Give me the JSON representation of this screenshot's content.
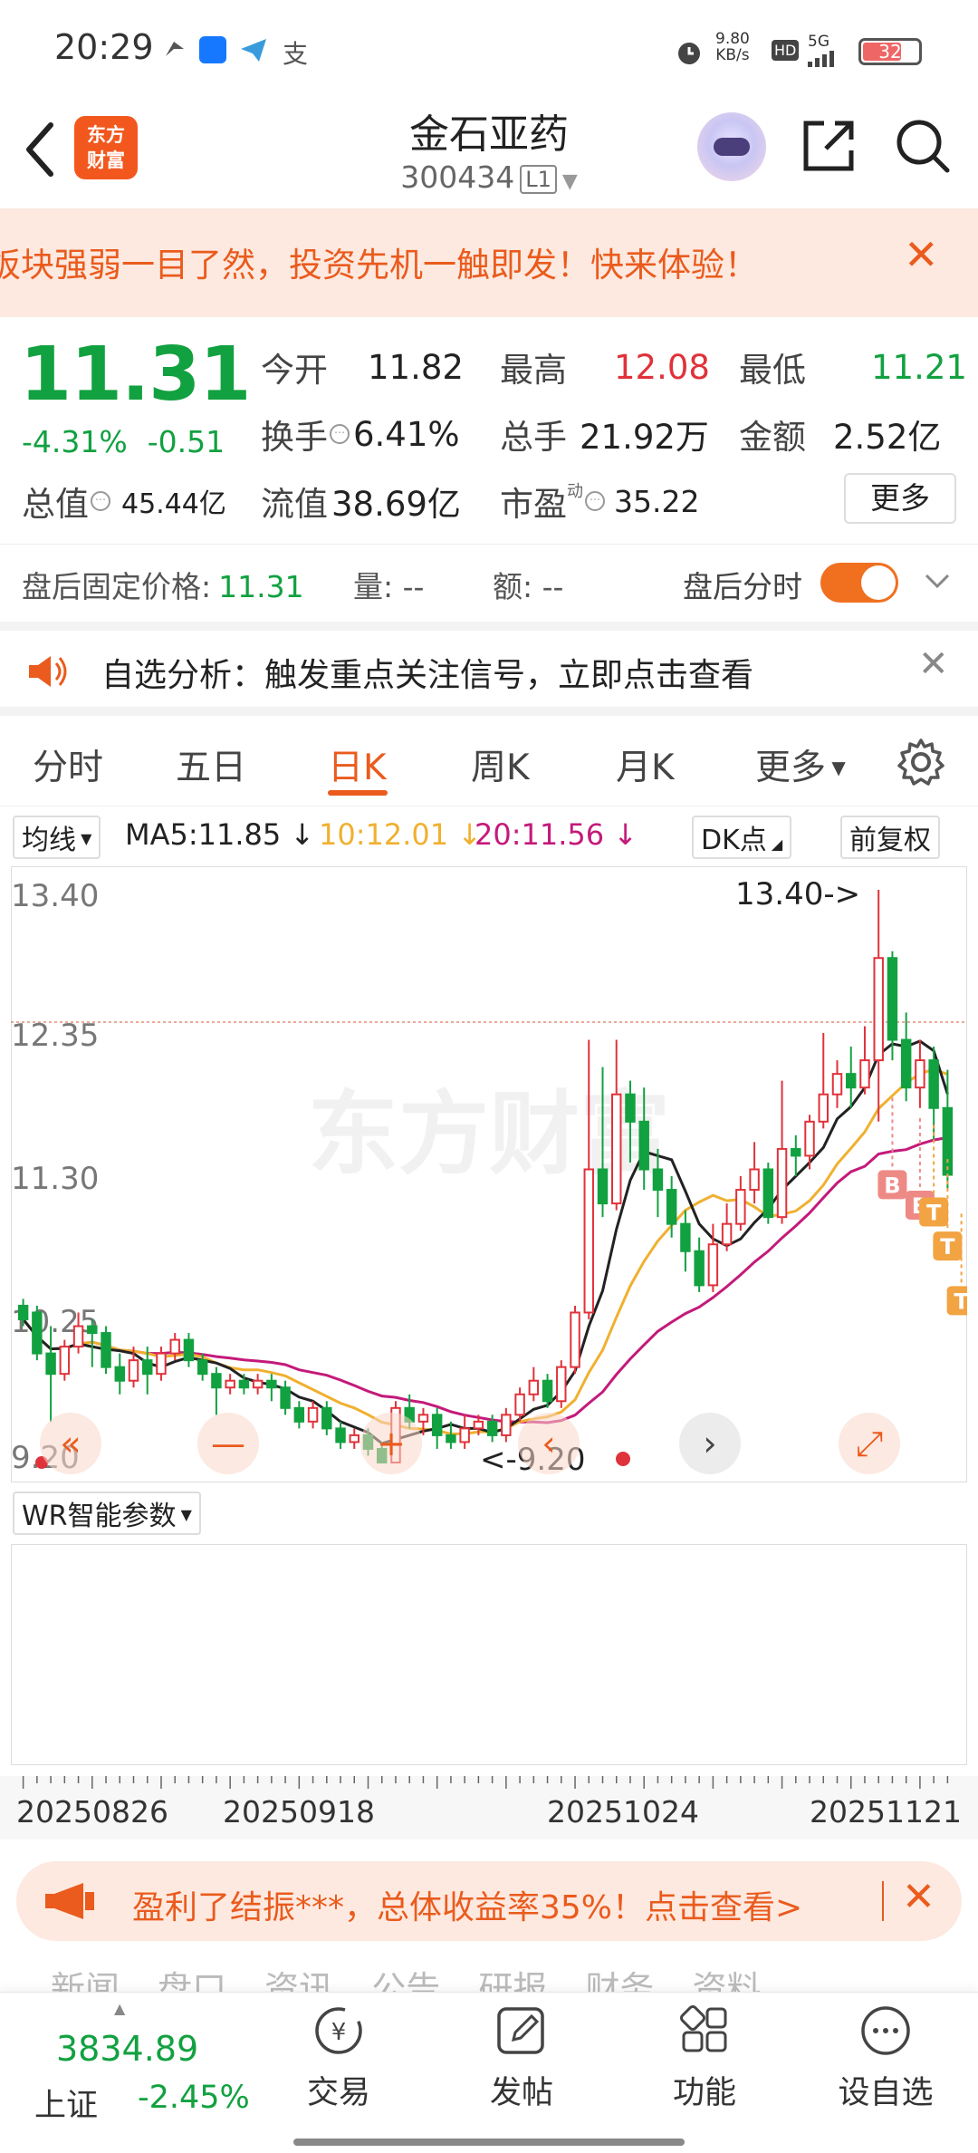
{
  "status_bar": {
    "time": "20:29",
    "net_speed_top": "9.80",
    "net_speed_unit": "KB/s",
    "hd": "HD",
    "signal": "5G",
    "battery": "32"
  },
  "header": {
    "logo_line1": "东方",
    "logo_line2": "财富",
    "title": "金石亚药",
    "code": "300434",
    "code_tag": "L1"
  },
  "promo_top": {
    "text": "板块强弱一目了然，投资先机一触即发！快来体验！",
    "close": "✕"
  },
  "quote": {
    "price": "11.31",
    "change_pct": "-4.31%",
    "change_abs": "-0.51",
    "open_label": "今开",
    "open": "11.82",
    "high_label": "最高",
    "high": "12.08",
    "low_label": "最低",
    "low": "11.21",
    "turnover_label": "换手",
    "turnover": "6.41%",
    "volume_label": "总手",
    "volume": "21.92万",
    "amount_label": "金额",
    "amount": "2.52亿",
    "total_value_label": "总值",
    "total_value": "45.44亿",
    "float_value_label": "流值",
    "float_value": "38.69亿",
    "pe_label": "市盈",
    "pe_sup": "动",
    "pe": "35.22",
    "more": "更多"
  },
  "after_hours": {
    "label": "盘后固定价格:",
    "price": "11.31",
    "vol_label": "量:",
    "vol": "--",
    "amt_label": "额:",
    "amt": "--",
    "toggle_label": "盘后分时"
  },
  "notice": {
    "text": "自选分析：触发重点关注信号，立即点击查看",
    "close": "✕"
  },
  "tabs": [
    "分时",
    "五日",
    "日K",
    "周K",
    "月K",
    "更多"
  ],
  "ma": {
    "selector": "均线",
    "ma5": "MA5:11.85 ↓",
    "ma10": "10:12.01 ↓",
    "ma20": "20:11.56 ↓",
    "dk": "DK点",
    "adjust": "前复权"
  },
  "colors": {
    "accent": "#ea5b1d",
    "up": "#e0323a",
    "down": "#12a140",
    "ma5": "#222222",
    "ma10": "#f0b030",
    "ma20": "#c41a7a"
  },
  "chart_data": {
    "type": "candlestick",
    "y_ticks": [
      "13.40",
      "12.35",
      "11.30",
      "10.25",
      "9.20"
    ],
    "ylim": [
      9.2,
      13.4
    ],
    "max_label": "13.40->",
    "min_label": "<-9.20",
    "x_labels": [
      "20250826",
      "20250918",
      "20251024",
      "20251121"
    ],
    "candles": [
      [
        10.35,
        10.25,
        10.4,
        10.2
      ],
      [
        10.3,
        10.0,
        10.35,
        9.95
      ],
      [
        10.0,
        9.85,
        10.2,
        9.5
      ],
      [
        9.85,
        10.05,
        10.1,
        9.8
      ],
      [
        10.05,
        10.2,
        10.3,
        10.0
      ],
      [
        10.2,
        10.15,
        10.25,
        9.9
      ],
      [
        10.15,
        9.9,
        10.2,
        9.85
      ],
      [
        9.9,
        9.8,
        10.0,
        9.7
      ],
      [
        9.8,
        9.95,
        10.05,
        9.75
      ],
      [
        9.95,
        9.85,
        10.05,
        9.7
      ],
      [
        9.85,
        10.0,
        10.05,
        9.8
      ],
      [
        10.0,
        10.1,
        10.15,
        9.95
      ],
      [
        10.1,
        9.95,
        10.15,
        9.9
      ],
      [
        9.95,
        9.85,
        10.0,
        9.8
      ],
      [
        9.85,
        9.75,
        9.9,
        9.55
      ],
      [
        9.75,
        9.8,
        9.85,
        9.7
      ],
      [
        9.8,
        9.75,
        9.85,
        9.7
      ],
      [
        9.75,
        9.8,
        9.85,
        9.7
      ],
      [
        9.8,
        9.75,
        9.85,
        9.65
      ],
      [
        9.75,
        9.6,
        9.8,
        9.55
      ],
      [
        9.6,
        9.5,
        9.65,
        9.45
      ],
      [
        9.5,
        9.6,
        9.65,
        9.45
      ],
      [
        9.6,
        9.45,
        9.65,
        9.4
      ],
      [
        9.45,
        9.35,
        9.5,
        9.3
      ],
      [
        9.35,
        9.4,
        9.45,
        9.3
      ],
      [
        9.4,
        9.3,
        9.45,
        9.25
      ],
      [
        9.3,
        9.2,
        9.35,
        9.2
      ],
      [
        9.2,
        9.6,
        9.65,
        9.2
      ],
      [
        9.6,
        9.5,
        9.7,
        9.45
      ],
      [
        9.5,
        9.55,
        9.6,
        9.4
      ],
      [
        9.55,
        9.4,
        9.6,
        9.3
      ],
      [
        9.4,
        9.35,
        9.5,
        9.3
      ],
      [
        9.35,
        9.45,
        9.55,
        9.3
      ],
      [
        9.45,
        9.5,
        9.55,
        9.4
      ],
      [
        9.5,
        9.4,
        9.55,
        9.35
      ],
      [
        9.4,
        9.55,
        9.6,
        9.35
      ],
      [
        9.55,
        9.7,
        9.75,
        9.5
      ],
      [
        9.7,
        9.8,
        9.9,
        9.65
      ],
      [
        9.8,
        9.65,
        9.85,
        9.6
      ],
      [
        9.65,
        9.9,
        9.95,
        9.6
      ],
      [
        9.9,
        10.3,
        10.35,
        9.85
      ],
      [
        10.3,
        11.35,
        12.3,
        10.25
      ],
      [
        11.35,
        11.1,
        12.1,
        11.0
      ],
      [
        11.1,
        11.9,
        12.3,
        11.05
      ],
      [
        11.9,
        11.7,
        12.0,
        11.4
      ],
      [
        11.7,
        11.35,
        11.95,
        11.2
      ],
      [
        11.35,
        11.2,
        11.5,
        11.0
      ],
      [
        11.2,
        10.95,
        11.3,
        10.85
      ],
      [
        10.95,
        10.75,
        11.05,
        10.6
      ],
      [
        10.75,
        10.5,
        10.85,
        10.45
      ],
      [
        10.5,
        10.8,
        10.95,
        10.45
      ],
      [
        10.8,
        10.95,
        11.1,
        10.75
      ],
      [
        10.95,
        11.2,
        11.3,
        10.9
      ],
      [
        11.2,
        11.35,
        11.55,
        11.1
      ],
      [
        11.35,
        11.0,
        11.4,
        10.95
      ],
      [
        11.0,
        11.5,
        12.0,
        10.95
      ],
      [
        11.5,
        11.45,
        11.6,
        11.3
      ],
      [
        11.45,
        11.7,
        11.75,
        11.35
      ],
      [
        11.7,
        11.9,
        12.35,
        11.65
      ],
      [
        11.9,
        12.05,
        12.15,
        11.8
      ],
      [
        12.05,
        11.95,
        12.25,
        11.8
      ],
      [
        11.95,
        12.15,
        12.4,
        11.9
      ],
      [
        12.15,
        12.9,
        13.4,
        11.7
      ],
      [
        12.9,
        12.3,
        12.95,
        12.15
      ],
      [
        12.3,
        11.95,
        12.5,
        11.85
      ],
      [
        11.95,
        12.15,
        12.3,
        11.8
      ],
      [
        12.15,
        11.8,
        12.25,
        11.55
      ],
      [
        11.8,
        11.31,
        12.08,
        11.21
      ]
    ],
    "markers": [
      {
        "label": "B",
        "index": 63,
        "price": 11.45
      },
      {
        "label": "B",
        "index": 65,
        "price": 11.3
      },
      {
        "label": "T",
        "index": 66,
        "price": 11.25
      },
      {
        "label": "T",
        "index": 67,
        "price": 11.0
      },
      {
        "label": "T",
        "index": 68,
        "price": 10.6
      }
    ],
    "dashed_line_price": 12.35,
    "watermark": "东方财富"
  },
  "wr": {
    "selector": "WR智能参数"
  },
  "promo_bottom": {
    "text": "盈利了结振***，总体收益率35%！点击查看>",
    "close": "✕"
  },
  "subtabs": "新闻  盘口  资讯  公告  研报  财务  资料",
  "bottom_nav": {
    "index_value": "3834.89",
    "index_name": "上证",
    "index_change": "-2.45%",
    "items": [
      "交易",
      "发帖",
      "功能",
      "设自选"
    ]
  }
}
